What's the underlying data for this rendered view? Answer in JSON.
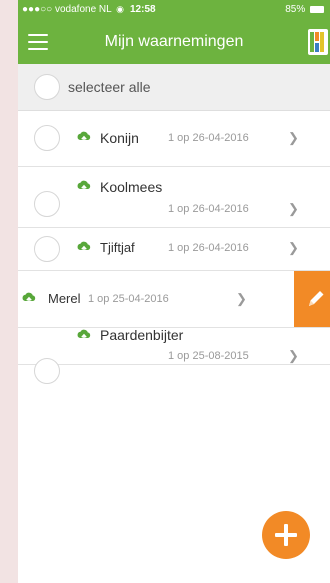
{
  "status_bar": {
    "carrier": "●●●○○ vodafone NL",
    "time": "12:58",
    "battery": "85%"
  },
  "nav": {
    "title": "Mijn waarnemingen",
    "menu_icon": "hamburger-icon",
    "logo_icon": "app-logo-icon"
  },
  "select_all": {
    "label": "selecteer alle"
  },
  "observations": [
    {
      "name": "Konijn",
      "count": "1 op 26-04-2016"
    },
    {
      "name": "Koolmees",
      "count": "1 op 26-04-2016"
    },
    {
      "name": "Tjiftjaf",
      "count": "1 op 26-04-2016"
    },
    {
      "name": "Merel",
      "count": "1 op 25-04-2016"
    },
    {
      "name": "Paardenbijter",
      "count": "1 op 25-08-2015"
    }
  ],
  "colors": {
    "primary_green": "#6db33f",
    "accent_orange": "#f28a26",
    "cloud_green": "#58a73a"
  },
  "icons": {
    "sync": "cloud-upload-icon",
    "chevron": "chevron-right-icon",
    "edit": "pencil-icon",
    "add": "plus-icon"
  }
}
